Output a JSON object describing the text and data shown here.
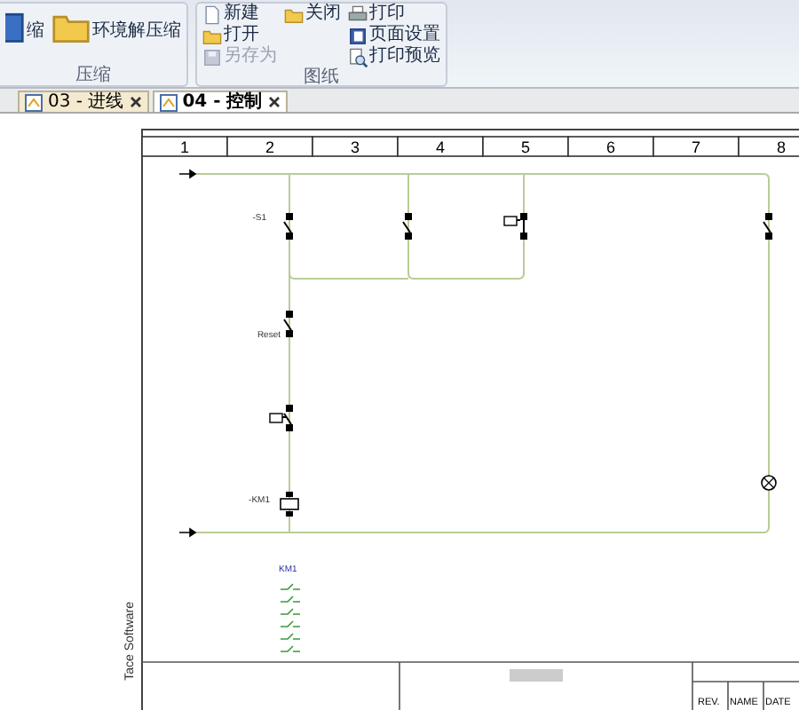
{
  "ribbon": {
    "groups": [
      {
        "label": "压缩",
        "buttons": [
          {
            "kind": "large",
            "label": "缩",
            "disabled": false
          },
          {
            "kind": "large",
            "label": "环境解压缩",
            "disabled": false
          }
        ]
      },
      {
        "label": "图纸",
        "buttons": [
          {
            "kind": "small",
            "label": "新建",
            "disabled": false
          },
          {
            "kind": "small",
            "label": "打开",
            "disabled": false
          },
          {
            "kind": "small",
            "label": "另存为",
            "disabled": true
          },
          {
            "kind": "small",
            "label": "关闭",
            "disabled": false
          },
          {
            "kind": "small",
            "label": "打印",
            "disabled": false
          },
          {
            "kind": "small",
            "label": "页面设置",
            "disabled": false
          },
          {
            "kind": "small",
            "label": "打印预览",
            "disabled": false
          }
        ]
      }
    ]
  },
  "tabs": [
    {
      "label": "03 - 进线",
      "selected": false,
      "closable": true
    },
    {
      "label": "04 - 控制",
      "selected": true,
      "closable": true
    }
  ],
  "drawing": {
    "columns": [
      "1",
      "2",
      "3",
      "4",
      "5",
      "6",
      "7",
      "8"
    ],
    "labels": [
      {
        "text": "-S1",
        "kind": "tag"
      },
      {
        "text": "Reset",
        "kind": "tag"
      },
      {
        "text": "-KM1",
        "kind": "tag"
      },
      {
        "text": "KM1",
        "kind": "heading"
      }
    ],
    "vertical_text": "Tace Software",
    "title_block": [
      "REV.",
      "NAME",
      "DATE"
    ]
  }
}
